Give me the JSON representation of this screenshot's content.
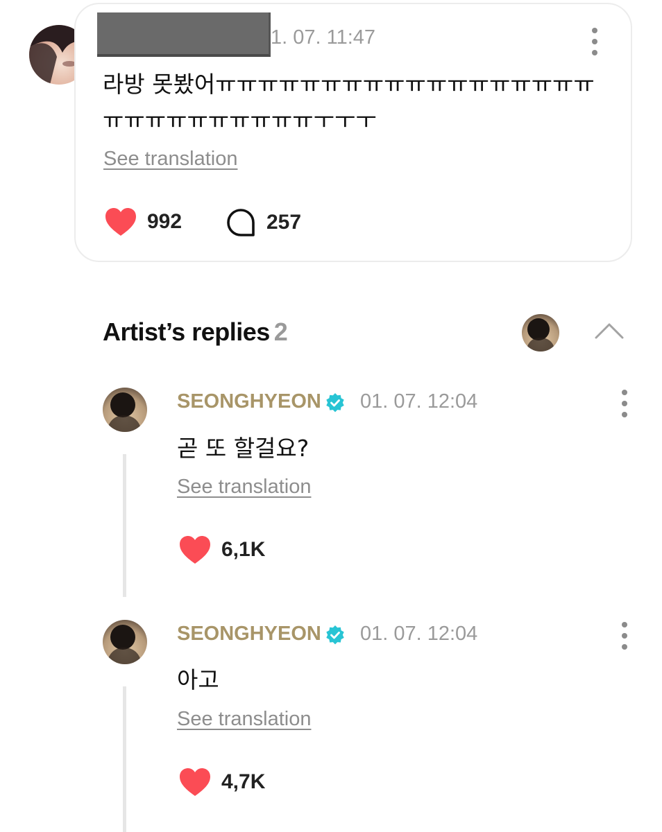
{
  "post": {
    "timestamp": "1. 07. 11:47",
    "text": "라방 못봤어ㅠㅠㅠㅠㅠㅠㅠㅠㅠㅠㅠㅠㅠㅠㅠㅠㅠㅠㅠㅠㅠㅠㅠㅠㅠㅠㅠㅠㅜㅜㅜ",
    "translation_link": "See translation",
    "likes": "992",
    "comments": "257"
  },
  "replies_section": {
    "title": "Artist’s replies",
    "count": "2"
  },
  "replies": [
    {
      "name": "SEONGHYEON",
      "time": "01. 07. 12:04",
      "text": "곧 또 할걸요?",
      "translation_link": "See translation",
      "likes": "6,1K"
    },
    {
      "name": "SEONGHYEON",
      "time": "01. 07. 12:04",
      "text": "아고",
      "translation_link": "See translation",
      "likes": "4,7K"
    }
  ],
  "colors": {
    "heart": "#fb4c55",
    "artist_name": "#a89568",
    "verified": "#28c4d4"
  }
}
